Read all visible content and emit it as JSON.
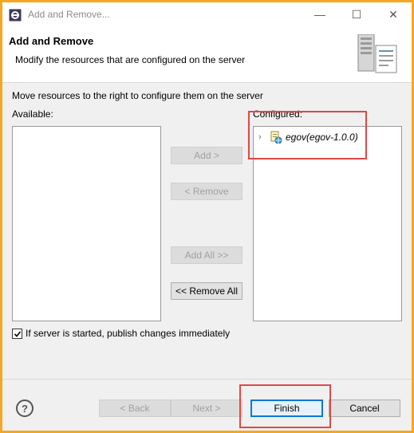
{
  "window": {
    "title": "Add and Remove...",
    "minimize_glyph": "—",
    "maximize_glyph": "☐",
    "close_glyph": "✕"
  },
  "header": {
    "title": "Add and Remove",
    "description": "Modify the resources that are configured on the server"
  },
  "main": {
    "instruction": "Move resources to the right to configure them on the server",
    "available_label": "Available:",
    "configured_label": "Configured:",
    "available_items": [],
    "configured_items": [
      {
        "label": "egov(egov-1.0.0)",
        "icon": "web-module-icon"
      }
    ]
  },
  "buttons": {
    "add": "Add >",
    "remove": "< Remove",
    "add_all": "Add All >>",
    "remove_all": "<< Remove All"
  },
  "options": {
    "publish_immediately_label": "If server is started, publish changes immediately",
    "publish_immediately_checked": true
  },
  "footer": {
    "help": "?",
    "back": "< Back",
    "next": "Next >",
    "finish": "Finish",
    "cancel": "Cancel"
  },
  "colors": {
    "highlight": "#e04848",
    "default_button_border": "#0078d7",
    "background": "#f0f0f0",
    "outer_frame": "#f5a623"
  }
}
